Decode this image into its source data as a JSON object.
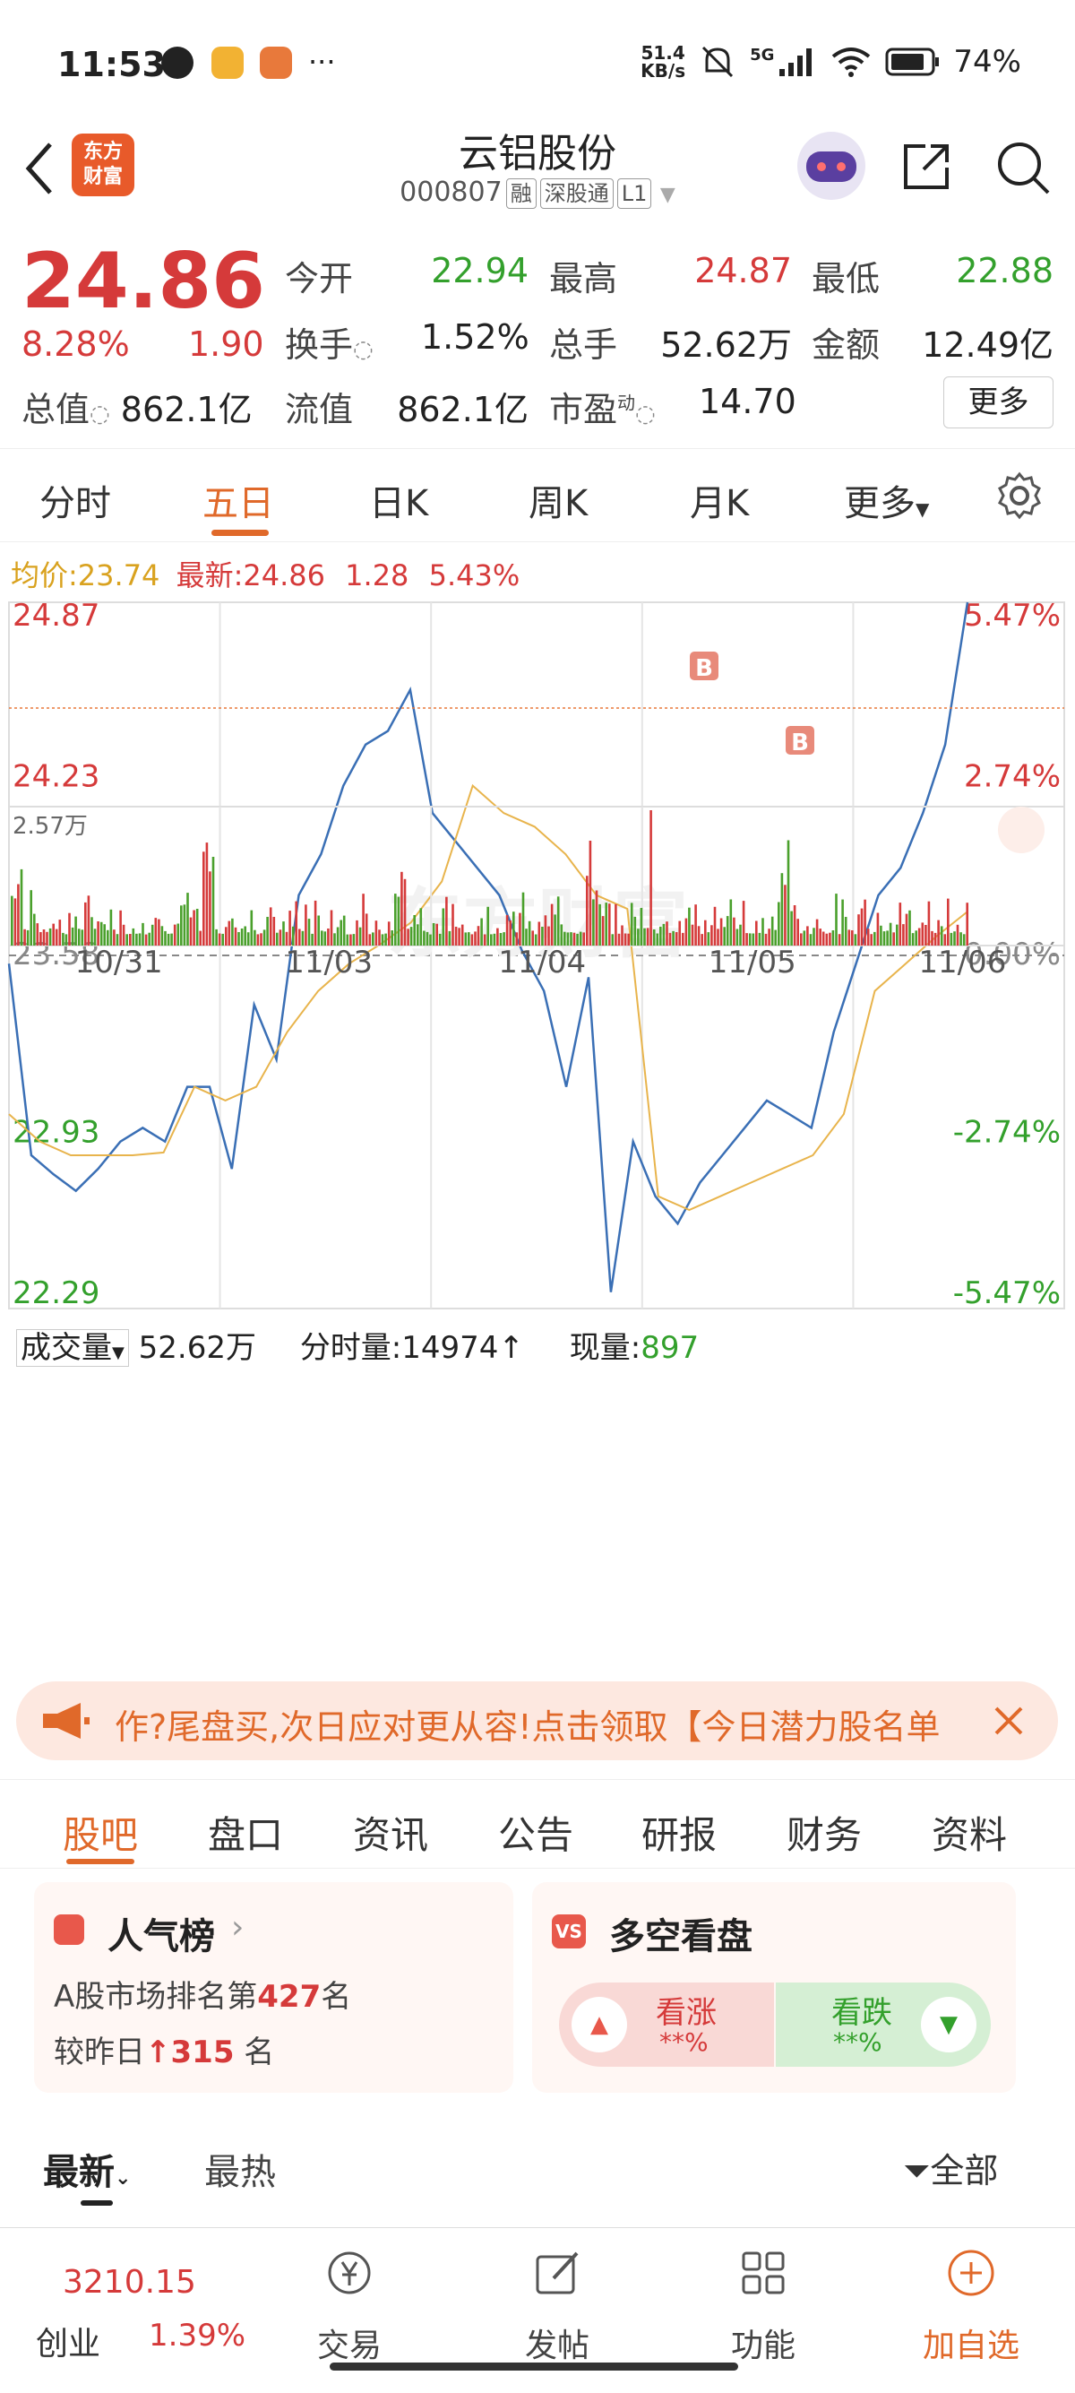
{
  "status": {
    "time": "11:53",
    "more": "···",
    "net_speed_top": "51.4",
    "net_speed_bottom": "KB/s",
    "signal": "5G",
    "battery": "74%"
  },
  "header": {
    "title": "云铝股份",
    "code": "000807",
    "tags": [
      "融",
      "深股通",
      "L1"
    ]
  },
  "quote": {
    "price": "24.86",
    "change_pct": "8.28%",
    "change": "1.90",
    "open_label": "今开",
    "open": "22.94",
    "high_label": "最高",
    "high": "24.87",
    "low_label": "最低",
    "low": "22.88",
    "turnover_label": "换手",
    "turnover": "1.52%",
    "volume_label": "总手",
    "volume": "52.62万",
    "amount_label": "金额",
    "amount": "12.49亿",
    "mktcap_label": "总值",
    "mktcap": "862.1亿",
    "float_label": "流值",
    "float": "862.1亿",
    "pe_label": "市盈",
    "pe_sup": "动",
    "pe": "14.70",
    "more": "更多"
  },
  "tabs": [
    "分时",
    "五日",
    "日K",
    "周K",
    "月K",
    "更多"
  ],
  "legend": {
    "avg_label": "均价:",
    "avg": "23.74",
    "latest_label": "最新:",
    "latest": "24.86",
    "chg": "1.28",
    "pct": "5.43%"
  },
  "chart_data": {
    "type": "line",
    "title": "",
    "y_labels_left": [
      "24.87",
      "24.23",
      "23.58",
      "22.93",
      "22.29"
    ],
    "y_labels_right": [
      "5.47%",
      "2.74%",
      "0.00%",
      "-2.74%",
      "-5.47%"
    ],
    "x_labels": [
      "10/31",
      "11/03",
      "11/04",
      "11/05",
      "11/06"
    ],
    "ylim": [
      22.29,
      24.87
    ],
    "prev_close": 23.58,
    "price_series": [
      23.55,
      22.85,
      22.78,
      22.72,
      22.8,
      22.9,
      22.95,
      22.9,
      23.1,
      23.1,
      22.8,
      23.4,
      23.2,
      23.8,
      23.95,
      24.2,
      24.35,
      24.4,
      24.55,
      24.1,
      24.0,
      23.9,
      23.8,
      23.6,
      23.45,
      23.1,
      23.5,
      22.35,
      22.9,
      22.7,
      22.6,
      22.75,
      22.85,
      22.95,
      23.05,
      23.0,
      22.95,
      23.3,
      23.55,
      23.8,
      23.9,
      24.1,
      24.35,
      24.87
    ],
    "avg_series": [
      23.0,
      22.9,
      22.85,
      22.85,
      22.85,
      22.86,
      23.1,
      23.05,
      23.1,
      23.3,
      23.45,
      23.55,
      23.62,
      23.7,
      23.85,
      24.2,
      24.1,
      24.05,
      23.95,
      23.8,
      23.75,
      22.7,
      22.65,
      22.7,
      22.75,
      22.8,
      22.85,
      23.0,
      23.45,
      23.55,
      23.65,
      23.74
    ],
    "volume": {
      "label": "成交量",
      "total": "52.62万",
      "tick_label": "分时量:",
      "tick": "14974",
      "now_label": "现量:",
      "now": "897",
      "max_label": "2.57万"
    }
  },
  "banner": {
    "text": "作?尾盘买,次日应对更从容!点击领取【今日潜力股名单"
  },
  "sections": [
    "股吧",
    "盘口",
    "资讯",
    "公告",
    "研报",
    "财务",
    "资料"
  ],
  "popular": {
    "title": "人气榜",
    "rank_text1": "A股市场排名第",
    "rank": "427",
    "rank_text2": "名",
    "change_text1": "较昨日",
    "change": "315",
    "change_text2": "名"
  },
  "bullbear": {
    "title": "多空看盘",
    "bull_label": "看涨",
    "bull_val": "**%",
    "bear_label": "看跌",
    "bear_val": "**%"
  },
  "feed": {
    "latest": "最新",
    "hot": "最热",
    "filter": "全部"
  },
  "bottom": {
    "index_value": "3210.15",
    "index_name": "创业",
    "index_pct": "1.39%",
    "trade": "交易",
    "post": "发帖",
    "func": "功能",
    "add": "加自选"
  },
  "colors": {
    "up": "#d53a3a",
    "down": "#33a02c",
    "accent": "#e0692a",
    "avg": "#e8b44c",
    "price_line": "#3a6fb5"
  }
}
